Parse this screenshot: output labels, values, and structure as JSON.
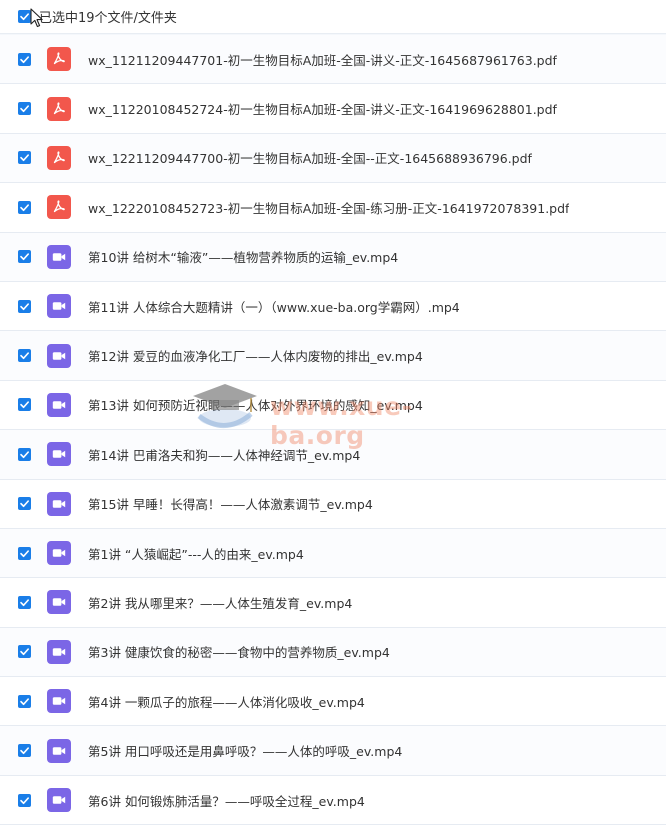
{
  "header": {
    "label": "已选中19个文件/文件夹",
    "checked": true
  },
  "watermark": {
    "text": "www.xue-ba.org",
    "icon": "graduation-cap-icon"
  },
  "files": [
    {
      "type": "pdf",
      "icon": "pdf-icon",
      "checked": true,
      "name": "wx_11211209447701-初一生物目标A加班-全国-讲义-正文-1645687961763.pdf"
    },
    {
      "type": "pdf",
      "icon": "pdf-icon",
      "checked": true,
      "name": "wx_11220108452724-初一生物目标A加班-全国-讲义-正文-1641969628801.pdf"
    },
    {
      "type": "pdf",
      "icon": "pdf-icon",
      "checked": true,
      "name": "wx_12211209447700-初一生物目标A加班-全国--正文-1645688936796.pdf"
    },
    {
      "type": "pdf",
      "icon": "pdf-icon",
      "checked": true,
      "name": "wx_12220108452723-初一生物目标A加班-全国-练习册-正文-1641972078391.pdf"
    },
    {
      "type": "mp4",
      "icon": "video-icon",
      "checked": true,
      "name": "第10讲 给树木“输液”——植物营养物质的运输_ev.mp4"
    },
    {
      "type": "mp4",
      "icon": "video-icon",
      "checked": true,
      "name": "第11讲 人体综合大题精讲（一）（www.xue-ba.org学霸网）.mp4"
    },
    {
      "type": "mp4",
      "icon": "video-icon",
      "checked": true,
      "name": "第12讲 爱豆的血液净化工厂——人体内废物的排出_ev.mp4"
    },
    {
      "type": "mp4",
      "icon": "video-icon",
      "checked": true,
      "name": "第13讲 如何预防近视眼——人体对外界环境的感知_ev.mp4"
    },
    {
      "type": "mp4",
      "icon": "video-icon",
      "checked": true,
      "name": "第14讲 巴甫洛夫和狗——人体神经调节_ev.mp4"
    },
    {
      "type": "mp4",
      "icon": "video-icon",
      "checked": true,
      "name": "第15讲 早睡！长得高！——人体激素调节_ev.mp4"
    },
    {
      "type": "mp4",
      "icon": "video-icon",
      "checked": true,
      "name": "第1讲 “人猿崛起”---人的由来_ev.mp4"
    },
    {
      "type": "mp4",
      "icon": "video-icon",
      "checked": true,
      "name": "第2讲 我从哪里来？——人体生殖发育_ev.mp4"
    },
    {
      "type": "mp4",
      "icon": "video-icon",
      "checked": true,
      "name": "第3讲 健康饮食的秘密——食物中的营养物质_ev.mp4"
    },
    {
      "type": "mp4",
      "icon": "video-icon",
      "checked": true,
      "name": "第4讲 一颗瓜子的旅程——人体消化吸收_ev.mp4"
    },
    {
      "type": "mp4",
      "icon": "video-icon",
      "checked": true,
      "name": "第5讲 用口呼吸还是用鼻呼吸？——人体的呼吸_ev.mp4"
    },
    {
      "type": "mp4",
      "icon": "video-icon",
      "checked": true,
      "name": "第6讲 如何锻炼肺活量？——呼吸全过程_ev.mp4"
    }
  ]
}
